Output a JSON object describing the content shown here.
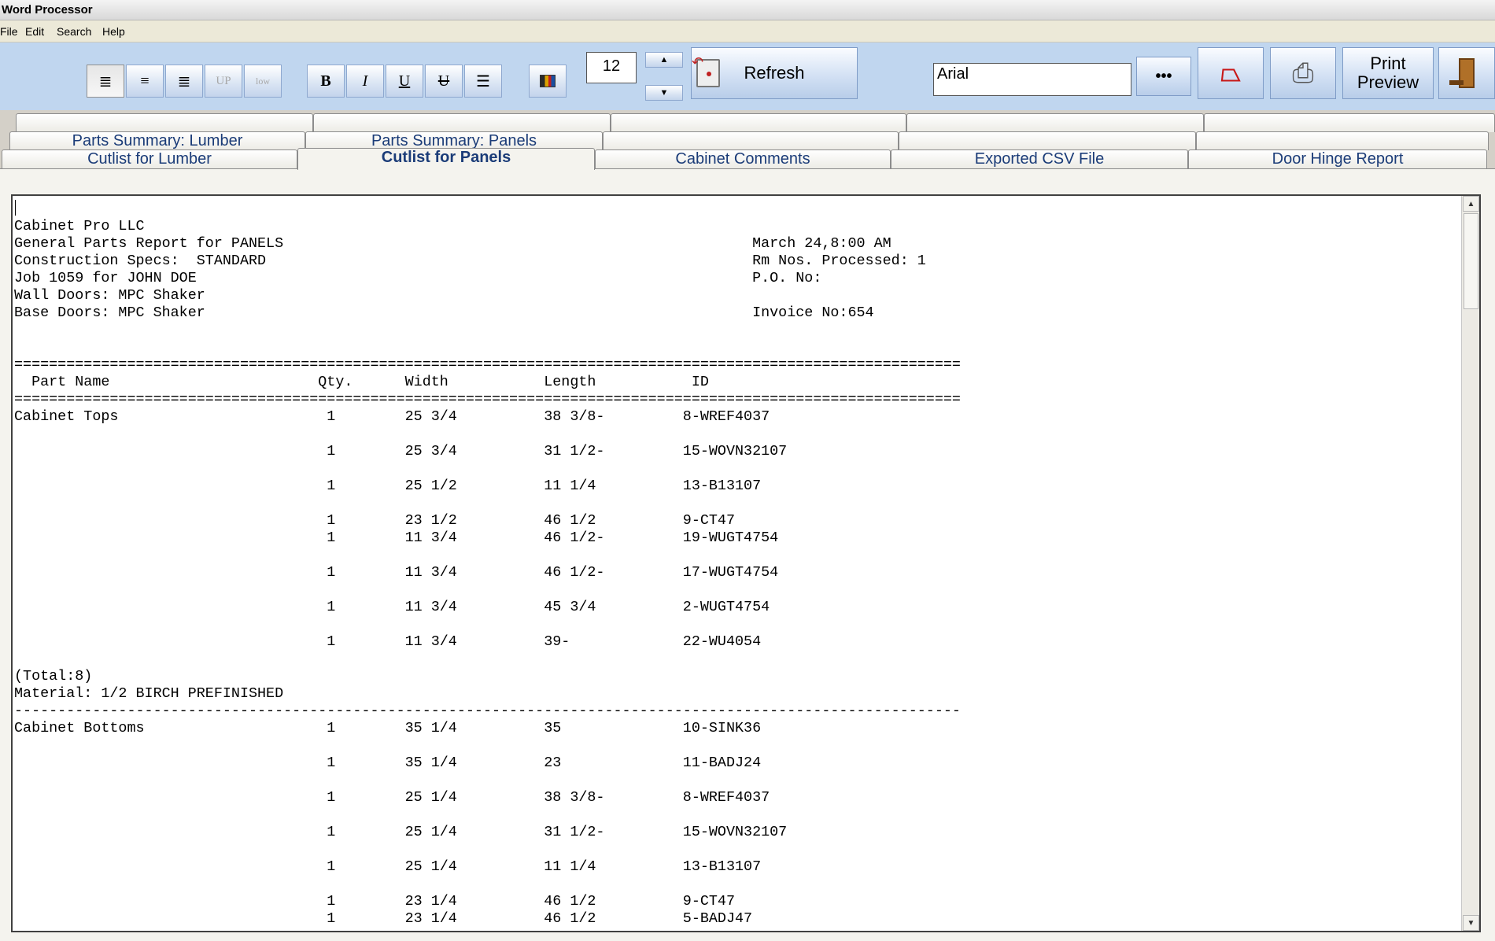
{
  "window": {
    "title": "Word Processor"
  },
  "menu": [
    "File",
    "Edit",
    "Search",
    "Help"
  ],
  "toolbar": {
    "align_buttons": [
      "≣",
      "≡",
      "≣",
      "UP",
      "low"
    ],
    "format_buttons": [
      "B",
      "I",
      "U",
      "U",
      "☰"
    ],
    "font_size": "12",
    "refresh_label": "Refresh",
    "font_name": "Arial",
    "more_label": "•••",
    "print_preview_label": "Print\nPreview"
  },
  "tabs": {
    "top_row": [
      "",
      "",
      "",
      "",
      ""
    ],
    "middle_row": [
      "Parts Summary: Lumber",
      "Parts Summary: Panels",
      "",
      "",
      ""
    ],
    "bottom_row": [
      "Cutlist for Lumber",
      "Cutlist for Panels",
      "Cabinet Comments",
      "Exported CSV File",
      "Door Hinge Report"
    ],
    "active": "Cutlist for Panels"
  },
  "report": {
    "header_left": [
      "Cabinet Pro LLC",
      "General Parts Report for PANELS",
      "Construction Specs:  STANDARD",
      "Job 1059 for JOHN DOE",
      "Wall Doors: MPC Shaker",
      "Base Doors: MPC Shaker"
    ],
    "header_right": [
      "",
      "March 24,8:00 AM",
      "Rm Nos. Processed: 1",
      "P.O. No:",
      "",
      "Invoice No:654"
    ],
    "columns": [
      "Part Name",
      "Qty.",
      "Width",
      "Length",
      "ID"
    ],
    "groups": [
      {
        "name": "Cabinet Tops",
        "rows": [
          {
            "qty": "1",
            "width": "25 3/4",
            "length": "38 3/8-",
            "id": "8-WREF4037",
            "gap": true
          },
          {
            "qty": "1",
            "width": "25 3/4",
            "length": "31 1/2-",
            "id": "15-WOVN32107",
            "gap": true
          },
          {
            "qty": "1",
            "width": "25 1/2",
            "length": "11 1/4",
            "id": "13-B13107",
            "gap": true
          },
          {
            "qty": "1",
            "width": "23 1/2",
            "length": "46 1/2",
            "id": "9-CT47",
            "gap": false
          },
          {
            "qty": "1",
            "width": "11 3/4",
            "length": "46 1/2-",
            "id": "19-WUGT4754",
            "gap": true
          },
          {
            "qty": "1",
            "width": "11 3/4",
            "length": "46 1/2-",
            "id": "17-WUGT4754",
            "gap": true
          },
          {
            "qty": "1",
            "width": "11 3/4",
            "length": "45 3/4",
            "id": "2-WUGT4754",
            "gap": true
          },
          {
            "qty": "1",
            "width": "11 3/4",
            "length": "39-",
            "id": "22-WU4054",
            "gap": true
          }
        ],
        "total": "(Total:8)",
        "material": "Material: 1/2 BIRCH PREFINISHED"
      },
      {
        "name": "Cabinet Bottoms",
        "rows": [
          {
            "qty": "1",
            "width": "35 1/4",
            "length": "35",
            "id": "10-SINK36",
            "gap": true
          },
          {
            "qty": "1",
            "width": "35 1/4",
            "length": "23",
            "id": "11-BADJ24",
            "gap": true
          },
          {
            "qty": "1",
            "width": "25 1/4",
            "length": "38 3/8-",
            "id": "8-WREF4037",
            "gap": true
          },
          {
            "qty": "1",
            "width": "25 1/4",
            "length": "31 1/2-",
            "id": "15-WOVN32107",
            "gap": true
          },
          {
            "qty": "1",
            "width": "25 1/4",
            "length": "11 1/4",
            "id": "13-B13107",
            "gap": true
          },
          {
            "qty": "1",
            "width": "23 1/4",
            "length": "46 1/2",
            "id": "9-CT47",
            "gap": false
          },
          {
            "qty": "1",
            "width": "23 1/4",
            "length": "46 1/2",
            "id": "5-BADJ47",
            "gap": false
          }
        ]
      }
    ]
  },
  "colors": {
    "toolbar_bg": "#c0d6ef",
    "tab_text": "#1b3c78"
  }
}
